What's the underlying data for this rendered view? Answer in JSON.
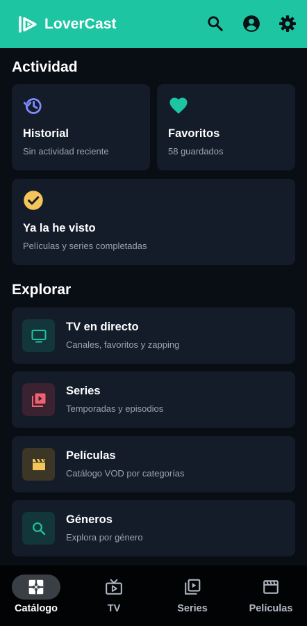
{
  "app": {
    "name": "LoverCast",
    "brand_color": "#1ec5a2"
  },
  "appbar": {
    "actions": [
      {
        "icon": "search-icon"
      },
      {
        "icon": "account-icon"
      },
      {
        "icon": "gear-icon"
      }
    ]
  },
  "activity": {
    "title": "Actividad",
    "cards": [
      {
        "icon": "history-icon",
        "icon_color": "#7f8cff",
        "title": "Historial",
        "subtitle": "Sin actividad reciente"
      },
      {
        "icon": "heart-icon",
        "icon_color": "#1ec5a2",
        "title": "Favoritos",
        "subtitle": "58 guardados"
      },
      {
        "icon": "check-circle-icon",
        "icon_color": "#f4c55a",
        "title": "Ya la he visto",
        "subtitle": "Películas y series completadas"
      }
    ]
  },
  "explore": {
    "title": "Explorar",
    "items": [
      {
        "icon": "tv-icon",
        "icon_color": "#1ec5a2",
        "tile_color": "#12363a",
        "title": "TV en directo",
        "subtitle": "Canales, favoritos y zapping"
      },
      {
        "icon": "video-library-icon",
        "icon_color": "#f0626f",
        "tile_color": "#3a2231",
        "title": "Series",
        "subtitle": "Temporadas y episodios"
      },
      {
        "icon": "movie-icon",
        "icon_color": "#f4c55a",
        "tile_color": "#3b3626",
        "title": "Películas",
        "subtitle": "Catálogo VOD por categorías"
      },
      {
        "icon": "search-icon",
        "icon_color": "#1ec5a2",
        "tile_color": "#12363a",
        "title": "Géneros",
        "subtitle": "Explora por género"
      }
    ]
  },
  "bottom_nav": {
    "active": "Catálogo",
    "items": [
      {
        "icon": "catalog-icon",
        "label": "Catálogo"
      },
      {
        "icon": "live-tv-icon",
        "label": "TV"
      },
      {
        "icon": "series-icon",
        "label": "Series"
      },
      {
        "icon": "movie-icon",
        "label": "Películas"
      }
    ]
  }
}
